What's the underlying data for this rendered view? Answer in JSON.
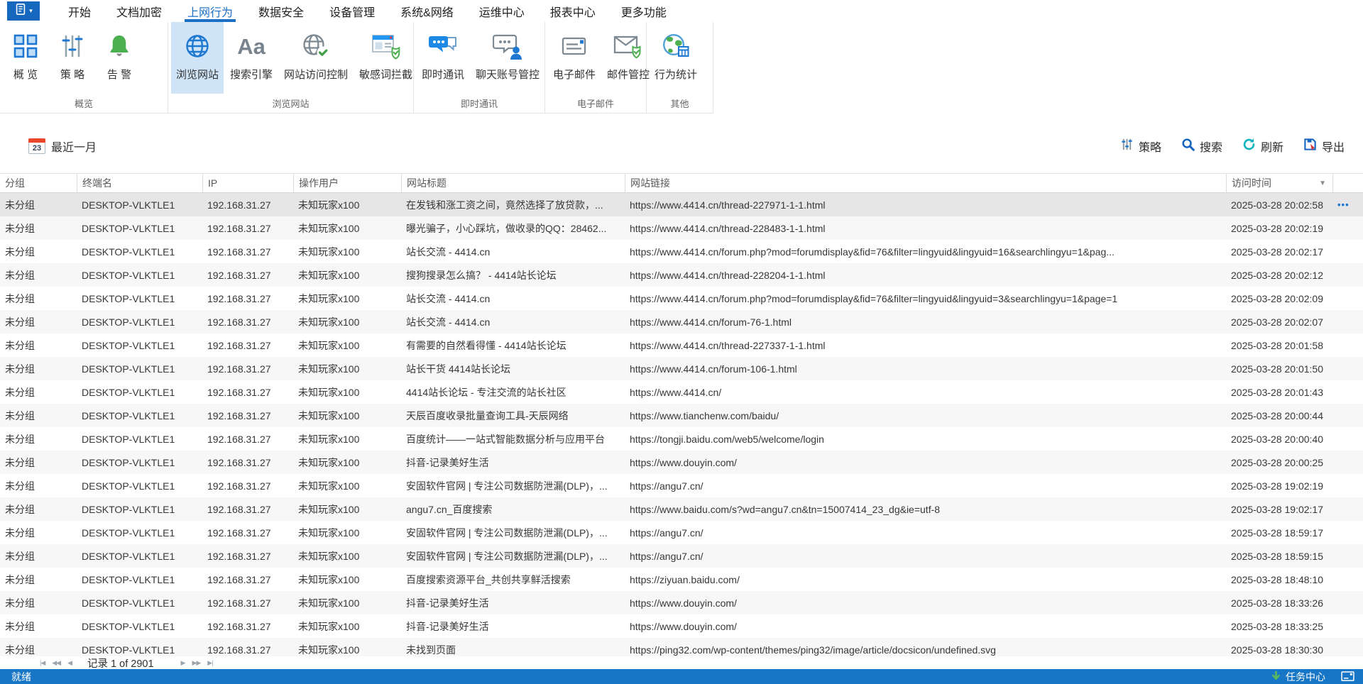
{
  "menu": {
    "caret": "▾",
    "tabs": [
      {
        "label": "开始"
      },
      {
        "label": "文档加密"
      },
      {
        "label": "上网行为",
        "active": true
      },
      {
        "label": "数据安全"
      },
      {
        "label": "设备管理"
      },
      {
        "label": "系统&网络"
      },
      {
        "label": "运维中心"
      },
      {
        "label": "报表中心"
      },
      {
        "label": "更多功能"
      }
    ]
  },
  "ribbon": {
    "aa_glyph": "Aa",
    "groups": [
      {
        "label": "概览",
        "buttons": [
          {
            "label": "概 览",
            "icon": "overview-grid-icon"
          },
          {
            "label": "策 略",
            "icon": "policy-sliders-icon"
          },
          {
            "label": "告 警",
            "icon": "alert-bell-icon"
          }
        ]
      },
      {
        "label": "浏览网站",
        "buttons": [
          {
            "label": "浏览网站",
            "icon": "browse-website-globe-icon",
            "selected": true
          },
          {
            "label": "搜索引擎",
            "icon": "search-engine-icon"
          },
          {
            "label": "网站访问控制",
            "icon": "site-access-control-icon"
          },
          {
            "label": "敏感词拦截",
            "icon": "sensitive-word-block-icon"
          }
        ]
      },
      {
        "label": "即时通讯",
        "buttons": [
          {
            "label": "即时通讯",
            "icon": "instant-message-icon"
          },
          {
            "label": "聊天账号管控",
            "icon": "chat-account-control-icon"
          }
        ]
      },
      {
        "label": "电子邮件",
        "buttons": [
          {
            "label": "电子邮件",
            "icon": "email-icon"
          },
          {
            "label": "邮件管控",
            "icon": "mail-control-icon"
          }
        ]
      },
      {
        "label": "其他",
        "buttons": [
          {
            "label": "行为统计",
            "icon": "behavior-stats-icon"
          }
        ]
      }
    ]
  },
  "toolbar": {
    "calendar_day": "23",
    "date_filter": "最近一月",
    "actions": [
      {
        "label": "策略",
        "icon": "policy-sliders-icon"
      },
      {
        "label": "搜索",
        "icon": "search-icon"
      },
      {
        "label": "刷新",
        "icon": "refresh-icon"
      },
      {
        "label": "导出",
        "icon": "export-icon"
      }
    ]
  },
  "table": {
    "columns": [
      "分组",
      "终端名",
      "IP",
      "操作用户",
      "网站标题",
      "网站链接",
      "访问时间"
    ],
    "sort_icon": "▼",
    "row_actions_glyph": "•••",
    "rows": [
      {
        "group": "未分组",
        "terminal": "DESKTOP-VLKTLE1",
        "ip": "192.168.31.27",
        "user": "未知玩家x100",
        "title": "在发钱和涨工资之间，竟然选择了放贷款，...",
        "url": "https://www.4414.cn/thread-227971-1-1.html",
        "time": "2025-03-28 20:02:58",
        "selected": true
      },
      {
        "group": "未分组",
        "terminal": "DESKTOP-VLKTLE1",
        "ip": "192.168.31.27",
        "user": "未知玩家x100",
        "title": "曝光骗子，小心踩坑，做收录的QQ：28462...",
        "url": "https://www.4414.cn/thread-228483-1-1.html",
        "time": "2025-03-28 20:02:19"
      },
      {
        "group": "未分组",
        "terminal": "DESKTOP-VLKTLE1",
        "ip": "192.168.31.27",
        "user": "未知玩家x100",
        "title": "站长交流 - 4414.cn",
        "url": "https://www.4414.cn/forum.php?mod=forumdisplay&fid=76&filter=lingyuid&lingyuid=16&searchlingyu=1&pag...",
        "time": "2025-03-28 20:02:17"
      },
      {
        "group": "未分组",
        "terminal": "DESKTOP-VLKTLE1",
        "ip": "192.168.31.27",
        "user": "未知玩家x100",
        "title": "搜狗搜录怎么搞？ - 4414站长论坛",
        "url": "https://www.4414.cn/thread-228204-1-1.html",
        "time": "2025-03-28 20:02:12"
      },
      {
        "group": "未分组",
        "terminal": "DESKTOP-VLKTLE1",
        "ip": "192.168.31.27",
        "user": "未知玩家x100",
        "title": "站长交流 - 4414.cn",
        "url": "https://www.4414.cn/forum.php?mod=forumdisplay&fid=76&filter=lingyuid&lingyuid=3&searchlingyu=1&page=1",
        "time": "2025-03-28 20:02:09"
      },
      {
        "group": "未分组",
        "terminal": "DESKTOP-VLKTLE1",
        "ip": "192.168.31.27",
        "user": "未知玩家x100",
        "title": "站长交流 - 4414.cn",
        "url": "https://www.4414.cn/forum-76-1.html",
        "time": "2025-03-28 20:02:07"
      },
      {
        "group": "未分组",
        "terminal": "DESKTOP-VLKTLE1",
        "ip": "192.168.31.27",
        "user": "未知玩家x100",
        "title": "有需要的自然看得懂 - 4414站长论坛",
        "url": "https://www.4414.cn/thread-227337-1-1.html",
        "time": "2025-03-28 20:01:58"
      },
      {
        "group": "未分组",
        "terminal": "DESKTOP-VLKTLE1",
        "ip": "192.168.31.27",
        "user": "未知玩家x100",
        "title": "站长干货  4414站长论坛",
        "url": "https://www.4414.cn/forum-106-1.html",
        "time": "2025-03-28 20:01:50"
      },
      {
        "group": "未分组",
        "terminal": "DESKTOP-VLKTLE1",
        "ip": "192.168.31.27",
        "user": "未知玩家x100",
        "title": "4414站长论坛 - 专注交流的站长社区",
        "url": "https://www.4414.cn/",
        "time": "2025-03-28 20:01:43"
      },
      {
        "group": "未分组",
        "terminal": "DESKTOP-VLKTLE1",
        "ip": "192.168.31.27",
        "user": "未知玩家x100",
        "title": "天辰百度收录批量查询工具-天辰网络",
        "url": "https://www.tianchenw.com/baidu/",
        "time": "2025-03-28 20:00:44"
      },
      {
        "group": "未分组",
        "terminal": "DESKTOP-VLKTLE1",
        "ip": "192.168.31.27",
        "user": "未知玩家x100",
        "title": "百度统计——一站式智能数据分析与应用平台",
        "url": "https://tongji.baidu.com/web5/welcome/login",
        "time": "2025-03-28 20:00:40"
      },
      {
        "group": "未分组",
        "terminal": "DESKTOP-VLKTLE1",
        "ip": "192.168.31.27",
        "user": "未知玩家x100",
        "title": "抖音-记录美好生活",
        "url": "https://www.douyin.com/",
        "time": "2025-03-28 20:00:25"
      },
      {
        "group": "未分组",
        "terminal": "DESKTOP-VLKTLE1",
        "ip": "192.168.31.27",
        "user": "未知玩家x100",
        "title": "安固软件官网 | 专注公司数据防泄漏(DLP)，...",
        "url": "https://angu7.cn/",
        "time": "2025-03-28 19:02:19"
      },
      {
        "group": "未分组",
        "terminal": "DESKTOP-VLKTLE1",
        "ip": "192.168.31.27",
        "user": "未知玩家x100",
        "title": "angu7.cn_百度搜索",
        "url": "https://www.baidu.com/s?wd=angu7.cn&tn=15007414_23_dg&ie=utf-8",
        "time": "2025-03-28 19:02:17"
      },
      {
        "group": "未分组",
        "terminal": "DESKTOP-VLKTLE1",
        "ip": "192.168.31.27",
        "user": "未知玩家x100",
        "title": "安固软件官网 | 专注公司数据防泄漏(DLP)，...",
        "url": "https://angu7.cn/",
        "time": "2025-03-28 18:59:17"
      },
      {
        "group": "未分组",
        "terminal": "DESKTOP-VLKTLE1",
        "ip": "192.168.31.27",
        "user": "未知玩家x100",
        "title": "安固软件官网 | 专注公司数据防泄漏(DLP)，...",
        "url": "https://angu7.cn/",
        "time": "2025-03-28 18:59:15"
      },
      {
        "group": "未分组",
        "terminal": "DESKTOP-VLKTLE1",
        "ip": "192.168.31.27",
        "user": "未知玩家x100",
        "title": "百度搜索资源平台_共创共享鲜活搜索",
        "url": "https://ziyuan.baidu.com/",
        "time": "2025-03-28 18:48:10"
      },
      {
        "group": "未分组",
        "terminal": "DESKTOP-VLKTLE1",
        "ip": "192.168.31.27",
        "user": "未知玩家x100",
        "title": "抖音-记录美好生活",
        "url": "https://www.douyin.com/",
        "time": "2025-03-28 18:33:26"
      },
      {
        "group": "未分组",
        "terminal": "DESKTOP-VLKTLE1",
        "ip": "192.168.31.27",
        "user": "未知玩家x100",
        "title": "抖音-记录美好生活",
        "url": "https://www.douyin.com/",
        "time": "2025-03-28 18:33:25"
      },
      {
        "group": "未分组",
        "terminal": "DESKTOP-VLKTLE1",
        "ip": "192.168.31.27",
        "user": "未知玩家x100",
        "title": "未找到页面",
        "url": "https://ping32.com/wp-content/themes/ping32/image/article/docsicon/undefined.svg",
        "time": "2025-03-28 18:30:30"
      }
    ]
  },
  "pager": {
    "nav_left": [
      "|◀",
      "◀◀",
      "◀"
    ],
    "record_label": "记录 1 of 2901",
    "nav_right": [
      "▶",
      "▶▶",
      "▶|"
    ]
  },
  "status": {
    "ready": "就绪",
    "task_center": "任务中心"
  },
  "colors": {
    "accent_blue": "#1e78d2",
    "active_tab": "#1b6fc5",
    "selected_button_bg": "#cfe5f7",
    "selected_row_bg": "#e6e6e6",
    "status_bar": "#1776c6",
    "green": "#4caf50",
    "calendar_red": "#e8472b"
  }
}
